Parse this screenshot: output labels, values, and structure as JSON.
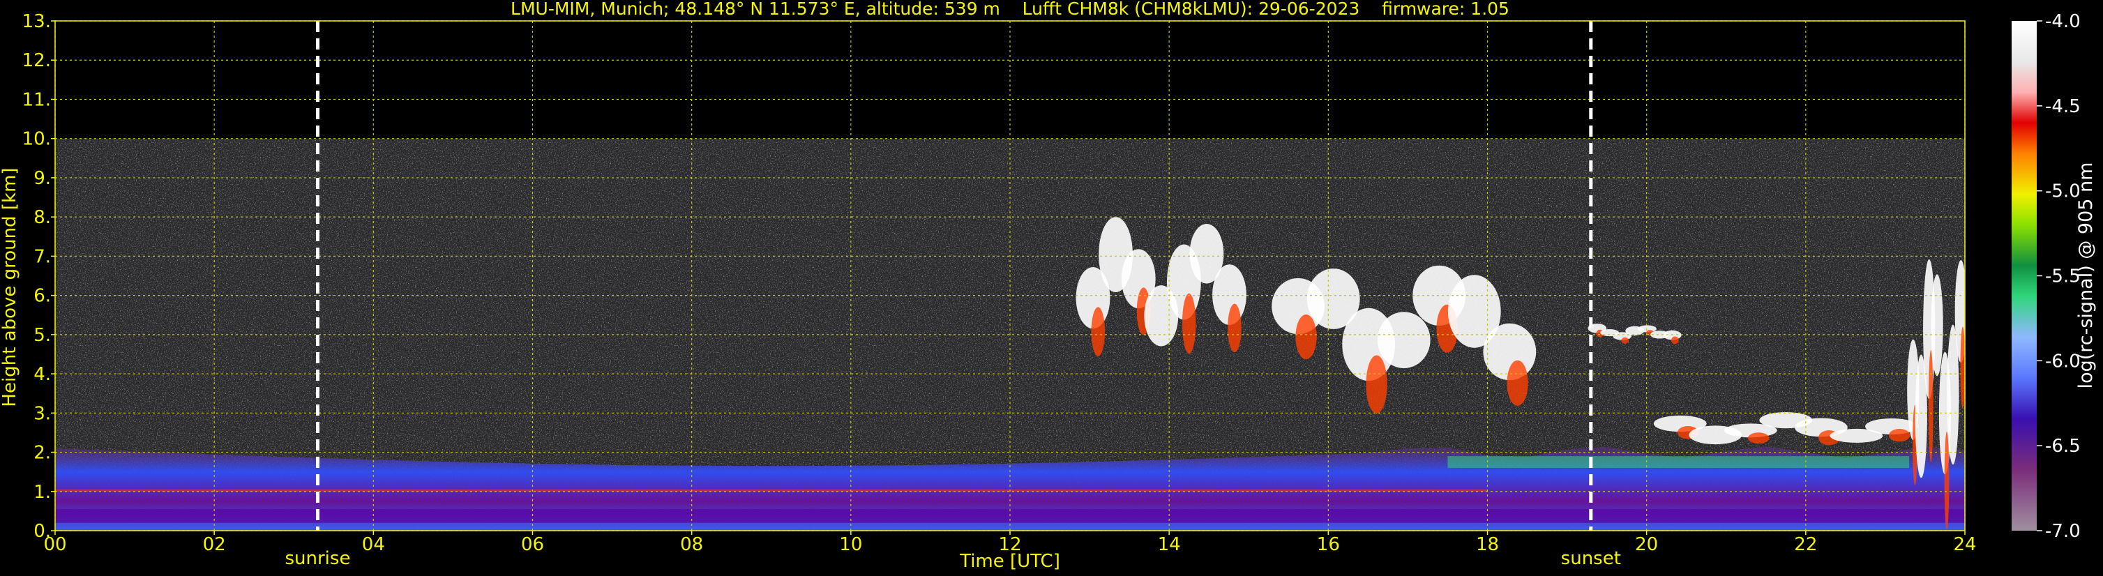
{
  "chart_data": {
    "type": "heatmap",
    "title": "LMU-MIM, Munich; 48.148° N 11.573° E, altitude: 539 m    Lufft CHM8k (CHM8kLMU): 29-06-2023    firmware: 1.05",
    "xlabel": "Time [UTC]",
    "ylabel": "Height above ground [km]",
    "xlim": [
      0,
      24
    ],
    "ylim": [
      0,
      13
    ],
    "x_ticks": [
      "00",
      "02",
      "04",
      "06",
      "08",
      "10",
      "12",
      "14",
      "16",
      "18",
      "20",
      "22",
      "24"
    ],
    "y_ticks": [
      "0.",
      "1.",
      "2.",
      "3.",
      "4.",
      "5.",
      "6.",
      "7.",
      "8.",
      "9.",
      "10.",
      "11.",
      "12.",
      "13."
    ],
    "grid": true,
    "measurement_top_km": 10,
    "markers": [
      {
        "label": "sunrise",
        "time": 3.3
      },
      {
        "label": "sunset",
        "time": 19.3
      }
    ],
    "colorbar": {
      "label": "log(rc-signal) @ 905 nm",
      "range": [
        -7.0,
        -4.0
      ],
      "ticks": [
        "-4.0",
        "-4.5",
        "-5.0",
        "-5.5",
        "-6.0",
        "-6.5",
        "-7.0"
      ]
    },
    "features": [
      {
        "name": "aerosol-layer",
        "t_start": 0,
        "t_end": 24,
        "h_top": 2.1
      },
      {
        "name": "cloud-1",
        "t_start": 12.9,
        "t_end": 14.9,
        "h_bottom": 4.2,
        "h_top": 7.4
      },
      {
        "name": "cloud-2",
        "t_start": 15.4,
        "t_end": 18.5,
        "h_bottom": 3.3,
        "h_top": 6.4
      },
      {
        "name": "cloud-3",
        "t_start": 19.3,
        "t_end": 20.4,
        "h_bottom": 4.8,
        "h_top": 5.2
      },
      {
        "name": "cloud-4",
        "t_start": 20.2,
        "t_end": 23.3,
        "h_bottom": 2.1,
        "h_top": 2.9
      },
      {
        "name": "cloud-5",
        "t_start": 23.3,
        "t_end": 24,
        "h_bottom": 0.3,
        "h_top": 6.3
      }
    ]
  },
  "colors": {
    "text": "#f5f500",
    "grid": "#c8c800",
    "colormap": [
      "#a090a0",
      "#7a2d7a",
      "#4a006e",
      "#2d20d0",
      "#5a78ff",
      "#8fb8ff",
      "#2fd67a",
      "#109040",
      "#8ce000",
      "#f0f000",
      "#ffa000",
      "#ff4000",
      "#e00000",
      "#ffb0b0",
      "#e8e8e8",
      "#ffffff"
    ]
  }
}
